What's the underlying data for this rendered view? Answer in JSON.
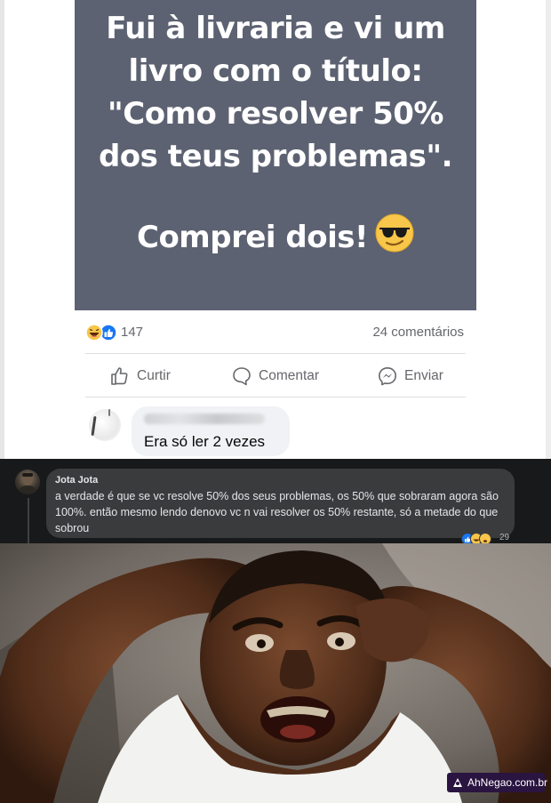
{
  "post": {
    "lines": [
      "Fui à livraria e vi um",
      "livro com o título:",
      "\"Como resolver 50%",
      "dos teus problemas\"."
    ],
    "punchline": "Comprei dois!",
    "emoji": "smiling-face-with-sunglasses",
    "reaction_count": "147",
    "comment_count": "24 comentários",
    "actions": {
      "like": "Curtir",
      "comment": "Comentar",
      "send": "Enviar"
    },
    "reply": {
      "text": "Era só ler 2 vezes"
    }
  },
  "dark_comment": {
    "author": "Jota Jota",
    "text": "a verdade é que se vc resolve 50% dos seus problemas, os 50% que sobraram agora são 100%. então mesmo lendo denovo vc n vai resolver os 50% restante, só a metade do que sobrou",
    "reaction_count": "29"
  },
  "meme": {
    "description_icon": "shocked-man-meme-image"
  },
  "watermark": {
    "text": "AhNegao.com.br"
  },
  "colors": {
    "card_bg": "#5d6272",
    "dark_bg": "#18191a",
    "dark_bubble": "#3a3b3c",
    "like_blue": "#1877f2",
    "watermark_bg": "#2a1440"
  }
}
